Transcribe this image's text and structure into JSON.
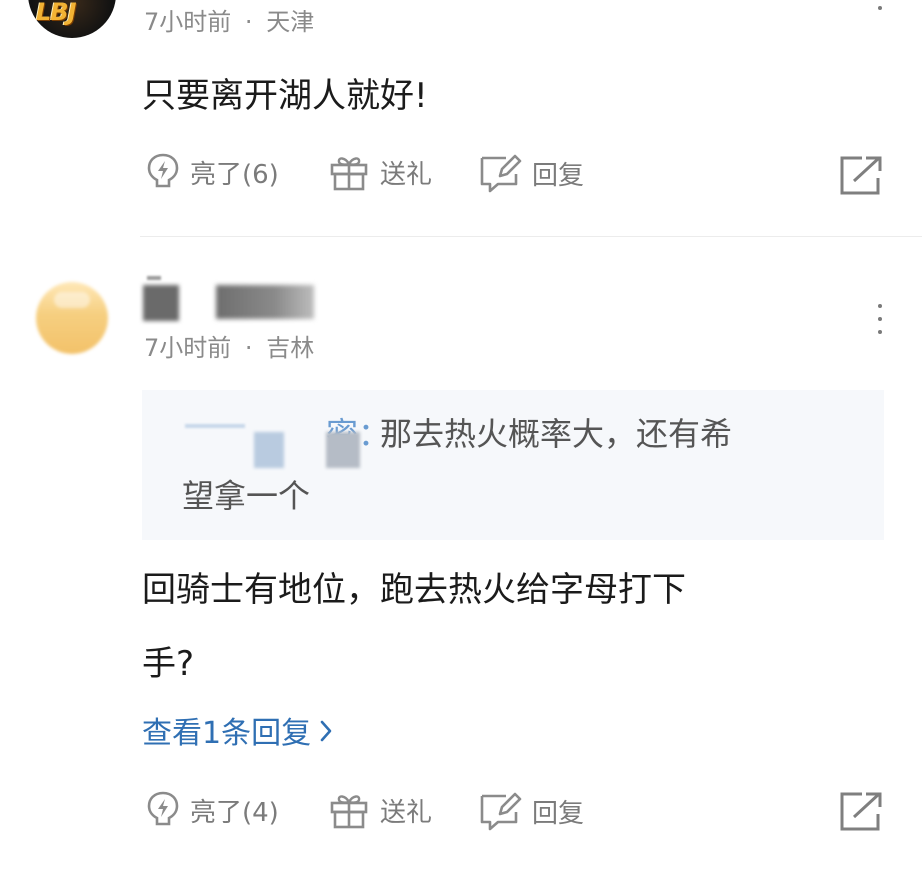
{
  "comments": [
    {
      "avatar_logo": "LBJ",
      "time": "7小时前",
      "location": "天津",
      "body": "只要离开湖人就好!",
      "actions": {
        "like_label": "亮了(6)",
        "gift_label": "送礼",
        "reply_label": "回复"
      }
    },
    {
      "time": "7小时前",
      "location": "吉林",
      "quote": {
        "author_fragment": "密：",
        "text_line1": "那去热火概率大，还有希",
        "text_line2": "望拿一个"
      },
      "body_line1": "回骑士有地位，跑去热火给字母打下",
      "body_line2": "手?",
      "view_replies": "查看1条回复",
      "actions": {
        "like_label": "亮了(4)",
        "gift_label": "送礼",
        "reply_label": "回复"
      }
    }
  ],
  "meta_separator": "·",
  "icons": {
    "like": "lightning-like-icon",
    "gift": "gift-icon",
    "reply": "edit-reply-icon",
    "share": "share-icon",
    "more": "more-vertical-icon",
    "chevron": "chevron-right-icon"
  },
  "colors": {
    "link": "#2f6fb3",
    "meta": "#8a8a8a",
    "action": "#7b7b7b",
    "quote_bg": "#f6f8fb"
  }
}
